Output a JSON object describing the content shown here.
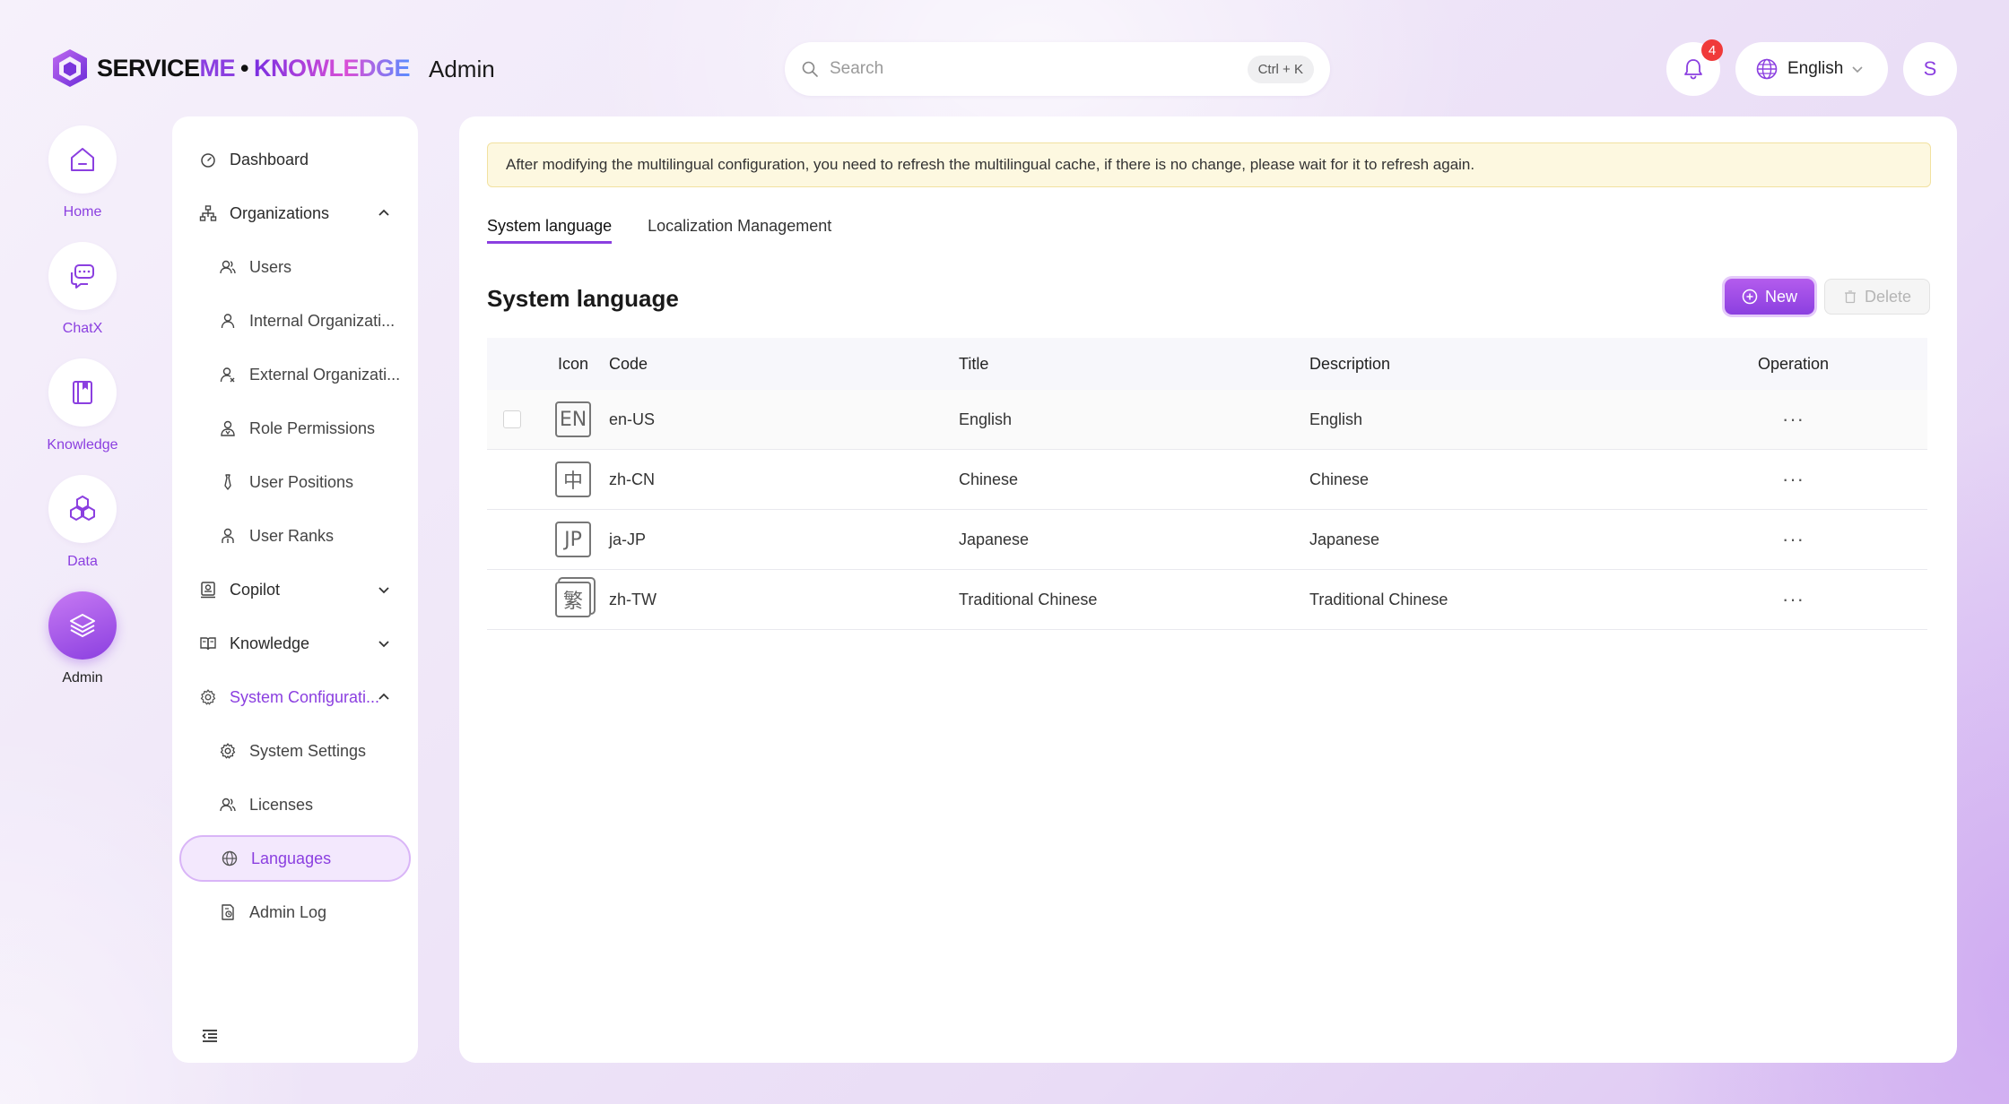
{
  "header": {
    "brand": {
      "part1": "SERVICE",
      "part2": "ME",
      "separator": "•",
      "part3": "KNOWLEDGE"
    },
    "app_title": "Admin",
    "search": {
      "placeholder": "Search",
      "shortcut": "Ctrl + K"
    },
    "notifications_count": "4",
    "language": "English",
    "avatar_initial": "S"
  },
  "rail": [
    {
      "label": "Home",
      "icon": "home-icon"
    },
    {
      "label": "ChatX",
      "icon": "chat-icon"
    },
    {
      "label": "Knowledge",
      "icon": "book-icon"
    },
    {
      "label": "Data",
      "icon": "hexagons-icon"
    },
    {
      "label": "Admin",
      "icon": "layers-icon",
      "active": true
    }
  ],
  "sidebar": {
    "items": [
      {
        "label": "Dashboard",
        "icon": "dashboard-icon"
      },
      {
        "label": "Organizations",
        "icon": "org-tree-icon",
        "expanded": true
      },
      {
        "label": "Users",
        "icon": "users-icon"
      },
      {
        "label": "Internal Organizati...",
        "icon": "user-icon"
      },
      {
        "label": "External Organizati...",
        "icon": "user-external-icon"
      },
      {
        "label": "Role Permissions",
        "icon": "role-icon"
      },
      {
        "label": "User Positions",
        "icon": "tie-icon"
      },
      {
        "label": "User Ranks",
        "icon": "rank-icon"
      },
      {
        "label": "Copilot",
        "icon": "copilot-icon",
        "expanded": false
      },
      {
        "label": "Knowledge",
        "icon": "open-book-icon",
        "expanded": false
      },
      {
        "label": "System Configurati...",
        "icon": "gear-icon",
        "expanded": true
      },
      {
        "label": "System Settings",
        "icon": "settings-icon"
      },
      {
        "label": "Licenses",
        "icon": "license-icon"
      },
      {
        "label": "Languages",
        "icon": "globe-icon",
        "selected": true
      },
      {
        "label": "Admin Log",
        "icon": "log-icon"
      }
    ]
  },
  "main": {
    "notice": "After modifying the multilingual configuration, you need to refresh the multilingual cache, if there is no change, please wait for it to refresh again.",
    "tabs": [
      {
        "label": "System language",
        "active": true
      },
      {
        "label": "Localization Management"
      }
    ],
    "section_title": "System language",
    "buttons": {
      "new": "New",
      "delete": "Delete"
    },
    "table": {
      "columns": [
        "Icon",
        "Code",
        "Title",
        "Description",
        "Operation"
      ],
      "rows": [
        {
          "icon_text": "EN",
          "code": "en-US",
          "title": "English",
          "description": "English",
          "operation": "···"
        },
        {
          "icon_text": "中",
          "code": "zh-CN",
          "title": "Chinese",
          "description": "Chinese",
          "operation": "···"
        },
        {
          "icon_text": "JP",
          "code": "ja-JP",
          "title": "Japanese",
          "description": "Japanese",
          "operation": "···"
        },
        {
          "icon_text": "繁",
          "code": "zh-TW",
          "title": "Traditional Chinese",
          "description": "Traditional Chinese",
          "operation": "···"
        }
      ]
    }
  },
  "colors": {
    "accent": "#8b3fe0",
    "notice_bg": "#fdf8e0",
    "badge": "#f03a3a"
  }
}
